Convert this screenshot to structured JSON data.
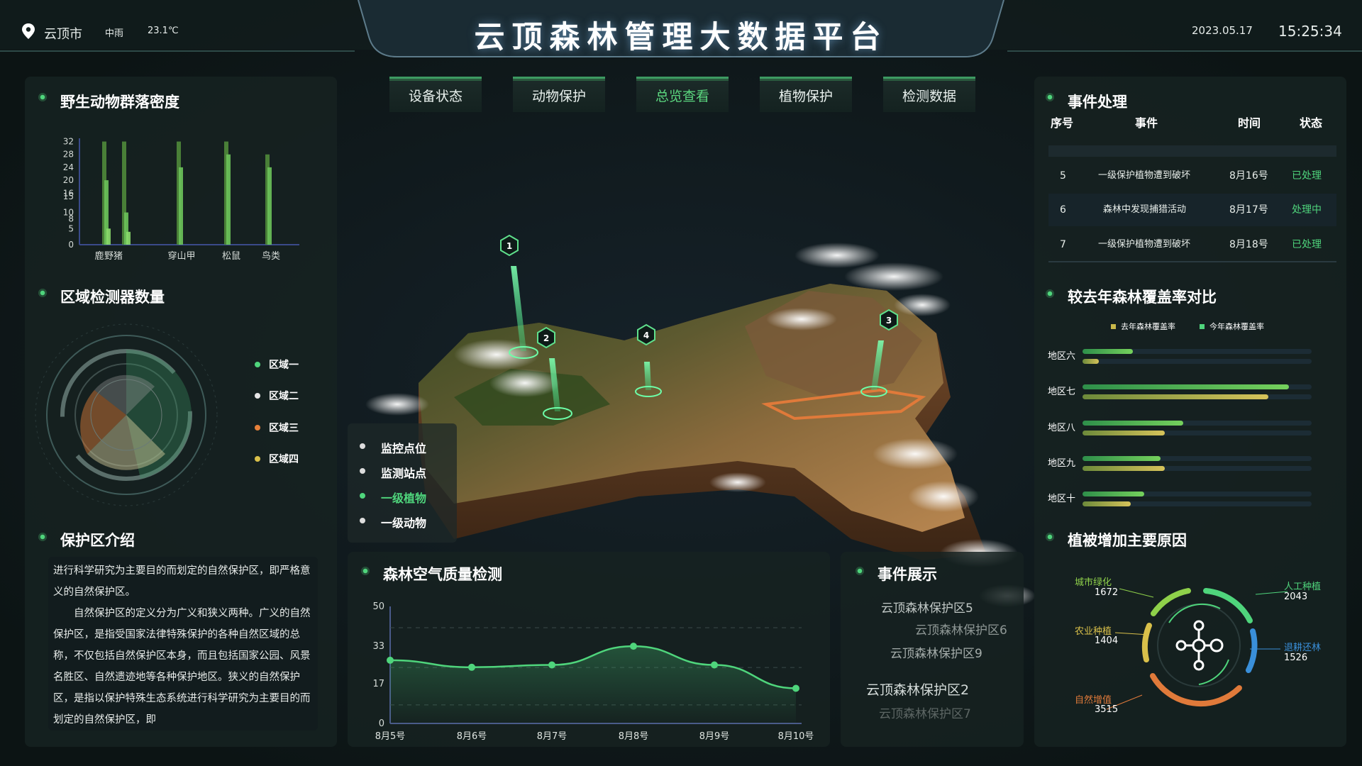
{
  "header": {
    "location": "云顶市",
    "weather": "中雨",
    "temperature": "23.1℃",
    "title": "云顶森林管理大数据平台",
    "date": "2023.05.17",
    "time": "15:25:34"
  },
  "nav": {
    "tabs": [
      {
        "label": "设备状态",
        "active": false
      },
      {
        "label": "动物保护",
        "active": false
      },
      {
        "label": "总览查看",
        "active": true
      },
      {
        "label": "植物保护",
        "active": false
      },
      {
        "label": "检测数据",
        "active": false
      }
    ]
  },
  "wildlife": {
    "title": "野生动物群落密度",
    "chart_data": {
      "type": "bar",
      "categories": [
        "鹿",
        "野猪",
        "穿山甲",
        "松鼠",
        "鸟类"
      ],
      "y_ticks": [
        "32",
        "28",
        "24",
        "20",
        "16",
        "15",
        "10",
        "8",
        "5",
        "0"
      ],
      "series": [
        {
          "values": [
            32,
            32,
            32,
            32,
            28
          ]
        },
        {
          "values": [
            20,
            10,
            24,
            28,
            24
          ]
        },
        {
          "values": [
            5,
            4,
            0,
            0,
            0
          ]
        }
      ],
      "ylim": [
        0,
        33
      ]
    }
  },
  "detectors": {
    "title": "区域检测器数量",
    "legend": [
      {
        "label": "区域一",
        "color": "#4fd57c"
      },
      {
        "label": "区域二",
        "color": "#e6e6e6"
      },
      {
        "label": "区域三",
        "color": "#e6803a"
      },
      {
        "label": "区域四",
        "color": "#d9c04a"
      }
    ]
  },
  "reserve": {
    "title": "保护区介绍",
    "paragraphs": [
      "进行科学研究为主要目的而划定的自然保护区，即严格意义的自然保护区。",
      "自然保护区的定义分为广义和狭义两种。广义的自然保护区，是指受国家法律特殊保护的各种自然区域的总称，不仅包括自然保护区本身，而且包括国家公园、风景名胜区、自然遗迹地等各种保护地区。狭义的自然保护区，是指以保护特殊生态系统进行科学研究为主要目的而划定的自然保护区，即"
    ]
  },
  "map": {
    "markers": [
      "1",
      "2",
      "3",
      "4"
    ],
    "legend": [
      {
        "label": "监控点位",
        "active": false
      },
      {
        "label": "监测站点",
        "active": false
      },
      {
        "label": "一级植物",
        "active": true
      },
      {
        "label": "一级动物",
        "active": false
      }
    ]
  },
  "air": {
    "title": "森林空气质量检测",
    "chart_data": {
      "type": "line",
      "x": [
        "8月5号",
        "8月6号",
        "8月7号",
        "8月8号",
        "8月9号",
        "8月10号"
      ],
      "values": [
        27,
        24,
        25,
        33,
        25,
        15
      ],
      "y_ticks": [
        "50",
        "33",
        "17",
        "0"
      ],
      "ylim": [
        0,
        50
      ]
    }
  },
  "showcase": {
    "title": "事件展示",
    "items": [
      "云顶森林保护区5",
      "云顶森林保护区6",
      "云顶森林保护区9",
      "云顶森林保护区2",
      "云顶森林保护区7"
    ]
  },
  "events": {
    "title": "事件处理",
    "headers": [
      "序号",
      "事件",
      "时间",
      "状态"
    ],
    "rows": [
      {
        "no": "5",
        "event": "一级保护植物遭到破坏",
        "time": "8月16号",
        "status": "已处理"
      },
      {
        "no": "6",
        "event": "森林中发现捕猎活动",
        "time": "8月17号",
        "status": "处理中"
      },
      {
        "no": "7",
        "event": "一级保护植物遭到破坏",
        "time": "8月18号",
        "status": "已处理"
      }
    ]
  },
  "coverage": {
    "title": "较去年森林覆盖率对比",
    "chart_data": {
      "type": "bar",
      "legend": [
        "去年森林覆盖率",
        "今年森林覆盖率"
      ],
      "categories": [
        "地区六",
        "地区七",
        "地区八",
        "地区九",
        "地区十"
      ],
      "series": [
        {
          "name": "今年森林覆盖率",
          "values": [
            0.22,
            0.9,
            0.44,
            0.34,
            0.27
          ]
        },
        {
          "name": "去年森林覆盖率",
          "values": [
            0.07,
            0.81,
            0.36,
            0.36,
            0.21
          ]
        }
      ],
      "xlim": [
        0,
        1
      ]
    }
  },
  "reasons": {
    "title": "植被增加主要原因",
    "items": [
      {
        "name": "城市绿化",
        "value": "1672",
        "color": "#8fd14a"
      },
      {
        "name": "农业种植",
        "value": "1404",
        "color": "#d9c04a"
      },
      {
        "name": "自然增值",
        "value": "3515",
        "color": "#e07a3a"
      },
      {
        "name": "人工种植",
        "value": "2043",
        "color": "#4fd57c"
      },
      {
        "name": "退耕还林",
        "value": "1526",
        "color": "#3a8fd9"
      }
    ]
  }
}
